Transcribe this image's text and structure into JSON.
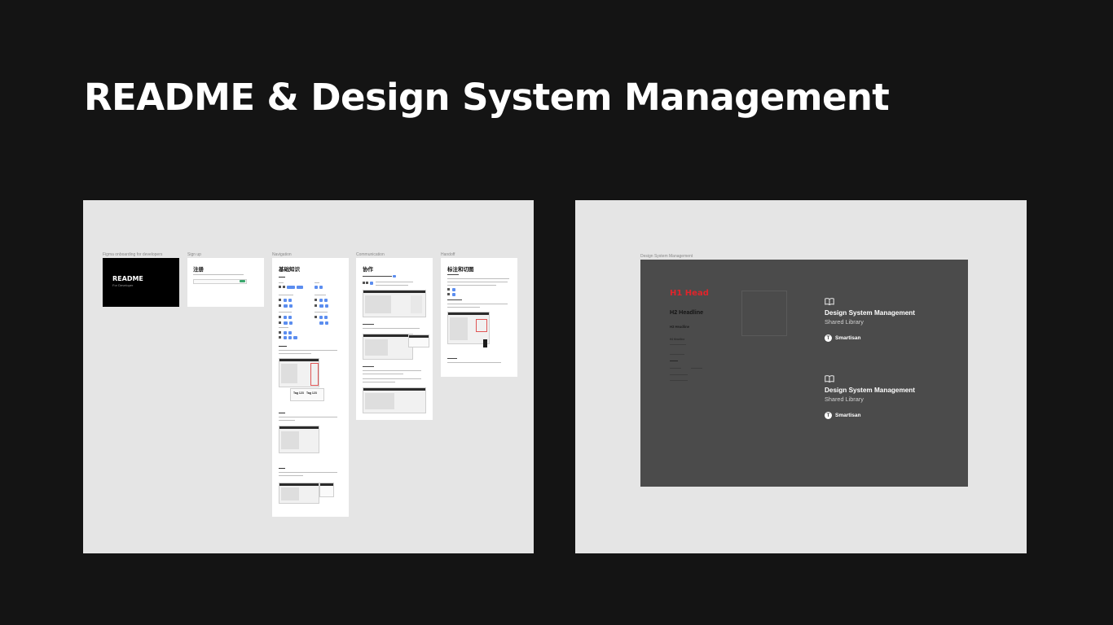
{
  "page": {
    "title": "README & Design System Management"
  },
  "left_board": {
    "frames": [
      {
        "label": "Figma onboarding for developers",
        "card_title": "README",
        "card_subtitle": "For Developer"
      },
      {
        "label": "Sign up",
        "heading": "注册"
      },
      {
        "label": "Navigation",
        "heading": "基础知识",
        "tags": [
          "Tag 123",
          "Tag 123"
        ]
      },
      {
        "label": "Communication",
        "heading": "协作"
      },
      {
        "label": "Handoff",
        "heading": "标注和切图"
      }
    ]
  },
  "right_board": {
    "label": "Design System Management",
    "typography": {
      "h1": "H1 Head",
      "h2": "H2 Headline",
      "h3": "H3 Headline",
      "h4": "H4 Headline"
    },
    "libraries": [
      {
        "title": "Design System Management",
        "subtitle": "Shared Library",
        "brand": "Smartisan",
        "brand_initial": "T"
      },
      {
        "title": "Design System Management",
        "subtitle": "Shared Library",
        "brand": "Smartisan",
        "brand_initial": "T"
      }
    ]
  },
  "icons": {
    "library": "book-icon",
    "brand": "brand-logo-icon"
  },
  "colors": {
    "background": "#141414",
    "canvas": "#e5e5e5",
    "accent_blue": "#5b8def",
    "headline_red": "#e0242b",
    "dark_frame": "#4b4b4b"
  }
}
